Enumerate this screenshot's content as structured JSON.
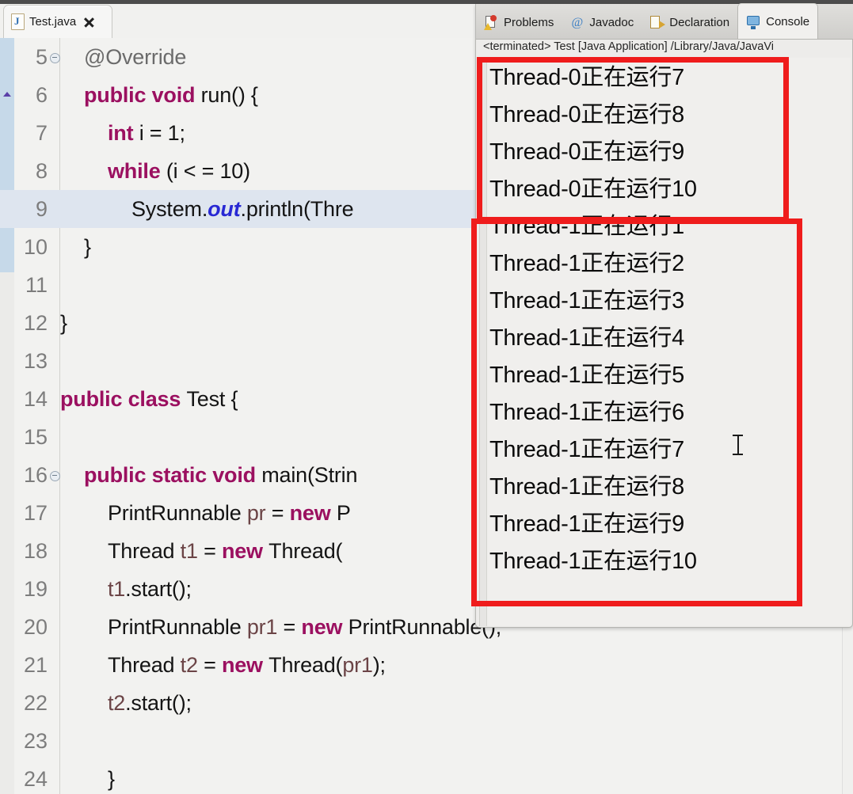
{
  "editor": {
    "tab": {
      "title": "Test.java",
      "icon": "java-file-icon",
      "close_icon": "close-icon"
    },
    "lines": [
      {
        "num": "5",
        "fold": true,
        "indent": 0,
        "tokens": [
          {
            "t": "@Override",
            "c": "ann"
          }
        ]
      },
      {
        "num": "6",
        "fold": false,
        "indent": 0,
        "tokens": [
          {
            "t": "public void ",
            "c": "kw"
          },
          {
            "t": "run() {",
            "c": "pln"
          }
        ]
      },
      {
        "num": "7",
        "fold": false,
        "indent": 1,
        "tokens": [
          {
            "t": "int ",
            "c": "kw"
          },
          {
            "t": "i = 1;",
            "c": "pln"
          }
        ]
      },
      {
        "num": "8",
        "fold": false,
        "indent": 1,
        "tokens": [
          {
            "t": "while ",
            "c": "kw"
          },
          {
            "t": "(i < = 10)",
            "c": "pln"
          }
        ]
      },
      {
        "num": "9",
        "fold": false,
        "indent": 2,
        "highlight": true,
        "tokens": [
          {
            "t": "System.",
            "c": "pln"
          },
          {
            "t": "out",
            "c": "fld"
          },
          {
            "t": ".println(Thre",
            "c": "pln"
          }
        ]
      },
      {
        "num": "10",
        "fold": false,
        "indent": 0,
        "tokens": [
          {
            "t": "}",
            "c": "pln"
          }
        ]
      },
      {
        "num": "11",
        "fold": false,
        "indent": 0,
        "tokens": []
      },
      {
        "num": "12",
        "fold": false,
        "indent": -1,
        "tokens": [
          {
            "t": "}",
            "c": "pln"
          }
        ]
      },
      {
        "num": "13",
        "fold": false,
        "indent": 0,
        "tokens": []
      },
      {
        "num": "14",
        "fold": false,
        "indent": -1,
        "tokens": [
          {
            "t": "public class ",
            "c": "kw"
          },
          {
            "t": "Test {",
            "c": "pln"
          }
        ]
      },
      {
        "num": "15",
        "fold": false,
        "indent": 0,
        "tokens": []
      },
      {
        "num": "16",
        "fold": true,
        "indent": 0,
        "tokens": [
          {
            "t": "public static void ",
            "c": "kw"
          },
          {
            "t": "main(Strin",
            "c": "pln"
          }
        ]
      },
      {
        "num": "17",
        "fold": false,
        "indent": 1,
        "tokens": [
          {
            "t": "PrintRunnable ",
            "c": "pln"
          },
          {
            "t": "pr",
            "c": "loc"
          },
          {
            "t": " = ",
            "c": "pln"
          },
          {
            "t": "new ",
            "c": "kw"
          },
          {
            "t": "P",
            "c": "pln"
          }
        ]
      },
      {
        "num": "18",
        "fold": false,
        "indent": 1,
        "tokens": [
          {
            "t": "Thread ",
            "c": "pln"
          },
          {
            "t": "t1",
            "c": "loc"
          },
          {
            "t": " = ",
            "c": "pln"
          },
          {
            "t": "new ",
            "c": "kw"
          },
          {
            "t": "Thread(",
            "c": "pln"
          }
        ]
      },
      {
        "num": "19",
        "fold": false,
        "indent": 1,
        "tokens": [
          {
            "t": "t1",
            "c": "loc"
          },
          {
            "t": ".start();",
            "c": "pln"
          }
        ]
      },
      {
        "num": "20",
        "fold": false,
        "indent": 1,
        "tokens": [
          {
            "t": "PrintRunnable ",
            "c": "pln"
          },
          {
            "t": "pr1",
            "c": "loc"
          },
          {
            "t": " = ",
            "c": "pln"
          },
          {
            "t": "new ",
            "c": "kw"
          },
          {
            "t": "PrintRunnable();",
            "c": "pln"
          }
        ]
      },
      {
        "num": "21",
        "fold": false,
        "indent": 1,
        "tokens": [
          {
            "t": "Thread ",
            "c": "pln"
          },
          {
            "t": "t2",
            "c": "loc"
          },
          {
            "t": " = ",
            "c": "pln"
          },
          {
            "t": "new ",
            "c": "kw"
          },
          {
            "t": "Thread(",
            "c": "pln"
          },
          {
            "t": "pr1",
            "c": "loc"
          },
          {
            "t": ");",
            "c": "pln"
          }
        ]
      },
      {
        "num": "22",
        "fold": false,
        "indent": 1,
        "tokens": [
          {
            "t": "t2",
            "c": "loc"
          },
          {
            "t": ".start();",
            "c": "pln"
          }
        ]
      },
      {
        "num": "23",
        "fold": false,
        "indent": 0,
        "tokens": []
      },
      {
        "num": "24",
        "fold": false,
        "indent": 1,
        "tokens": [
          {
            "t": "}",
            "c": "pln"
          }
        ]
      }
    ]
  },
  "console_view": {
    "tabs": [
      {
        "label": "Problems",
        "icon": "problems-icon",
        "active": false
      },
      {
        "label": "Javadoc",
        "icon": "javadoc-icon",
        "active": false
      },
      {
        "label": "Declaration",
        "icon": "declaration-icon",
        "active": false
      },
      {
        "label": "Console",
        "icon": "console-icon",
        "active": true
      }
    ],
    "launch_label": "<terminated> Test [Java Application] /Library/Java/JavaVi",
    "output": [
      "Thread-0正在运行7",
      "Thread-0正在运行8",
      "Thread-0正在运行9",
      "Thread-0正在运行10",
      "Thread-1正在运行1",
      "Thread-1正在运行2",
      "Thread-1正在运行3",
      "Thread-1正在运行4",
      "Thread-1正在运行5",
      "Thread-1正在运行6",
      "Thread-1正在运行7",
      "Thread-1正在运行8",
      "Thread-1正在运行9",
      "Thread-1正在运行10"
    ]
  },
  "annotations": {
    "highlight_color": "#ef1c1c",
    "boxes": [
      {
        "name": "thread-0-output-highlight"
      },
      {
        "name": "thread-1-output-highlight"
      }
    ]
  }
}
